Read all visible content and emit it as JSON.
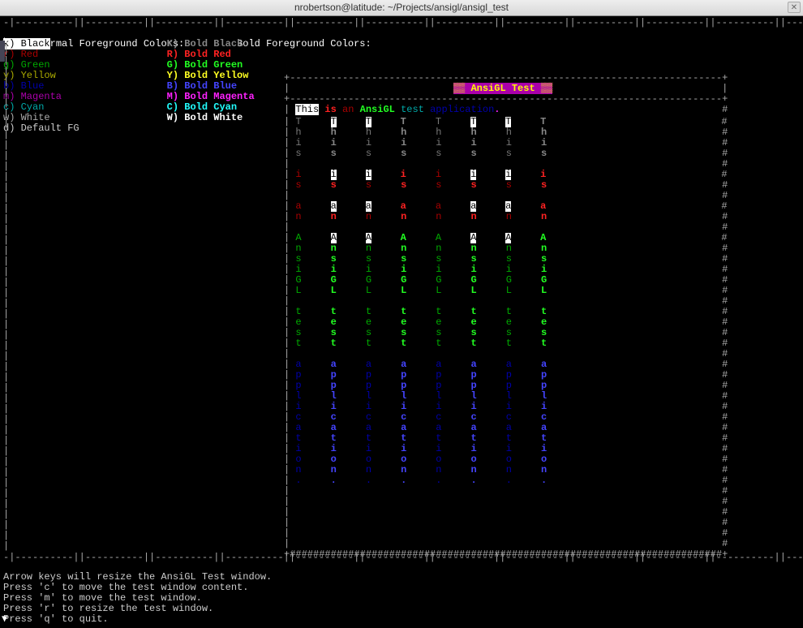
{
  "window": {
    "title": "nrobertson@latitude: ~/Projects/ansigl/ansigl_test"
  },
  "top_ruler": "-|----------||----------||----------||----------||----------||----------||----------||----------||----------||----------||----------||----------|-",
  "normal_header": "  Normal Foreground Colors:",
  "bold_header": "  Bold Foreground Colors:",
  "normal_items": [
    {
      "key": "k",
      "label": "k) Black",
      "cls": "sel"
    },
    {
      "key": "r",
      "label": "r) Red",
      "cls": "r"
    },
    {
      "key": "g",
      "label": "g) Green",
      "cls": "g"
    },
    {
      "key": "y",
      "label": "y) Yellow",
      "cls": "y"
    },
    {
      "key": "b",
      "label": "b) Blue",
      "cls": "b"
    },
    {
      "key": "m",
      "label": "m) Magenta",
      "cls": "m"
    },
    {
      "key": "c",
      "label": "c) Cyan",
      "cls": "c"
    },
    {
      "key": "w",
      "label": "w) White",
      "cls": "w"
    },
    {
      "key": "d",
      "label": "d) Default FG",
      "cls": "d"
    }
  ],
  "bold_items": [
    {
      "key": "K",
      "label": "K) Bold Black",
      "cls": "K"
    },
    {
      "key": "R",
      "label": "R) Bold Red",
      "cls": "R"
    },
    {
      "key": "G",
      "label": "G) Bold Green",
      "cls": "G"
    },
    {
      "key": "Y",
      "label": "Y) Bold Yellow",
      "cls": "Y"
    },
    {
      "key": "B",
      "label": "B) Bold Blue",
      "cls": "B"
    },
    {
      "key": "M",
      "label": "M) Bold Magenta",
      "cls": "M"
    },
    {
      "key": "C",
      "label": "C) Bold Cyan",
      "cls": "C"
    },
    {
      "key": "W",
      "label": "W) Bold White",
      "cls": "W"
    }
  ],
  "banner": "▒▒ AnsiGL Test ▒▒",
  "test_words": [
    {
      "text": "This",
      "cls": "test-this-sel"
    },
    {
      "text": " ",
      "cls": "d"
    },
    {
      "text": "is",
      "cls": "R"
    },
    {
      "text": " ",
      "cls": "d"
    },
    {
      "text": "an",
      "cls": "r"
    },
    {
      "text": " ",
      "cls": "d"
    },
    {
      "text": "AnsiGL",
      "cls": "G"
    },
    {
      "text": " ",
      "cls": "d"
    },
    {
      "text": "test",
      "cls": "c"
    },
    {
      "text": " ",
      "cls": "d"
    },
    {
      "text": "application",
      "cls": "b"
    },
    {
      "text": ".",
      "cls": "M"
    }
  ],
  "vertical_words": [
    {
      "text": "This",
      "cls": "k"
    },
    {
      "text": "is",
      "cls": "r"
    },
    {
      "text": "an",
      "cls": "r"
    },
    {
      "text": "AnsiGL",
      "cls": "g"
    },
    {
      "text": "test",
      "cls": "g"
    },
    {
      "text": "application.",
      "cls": "b"
    }
  ],
  "grid_columns": [
    {
      "style": "normal",
      "highlight": false
    },
    {
      "style": "bold",
      "highlight": true
    },
    {
      "style": "normal",
      "highlight": true
    },
    {
      "style": "bold",
      "highlight": false
    },
    {
      "style": "normal",
      "highlight": false
    },
    {
      "style": "bold",
      "highlight": true
    },
    {
      "style": "normal",
      "highlight": true
    },
    {
      "style": "bold",
      "highlight": false
    }
  ],
  "grid_col_spacing": 5,
  "panel_width_chars": 74,
  "panel_border_char": "#",
  "panel_dash_char": "-",
  "help": [
    "Arrow keys will resize the AnsiGL Test window.",
    "Press 'c' to move the test window content.",
    "Press 'm' to move the test window.",
    "Press 'r' to resize the test window.",
    "Press 'q' to quit."
  ]
}
